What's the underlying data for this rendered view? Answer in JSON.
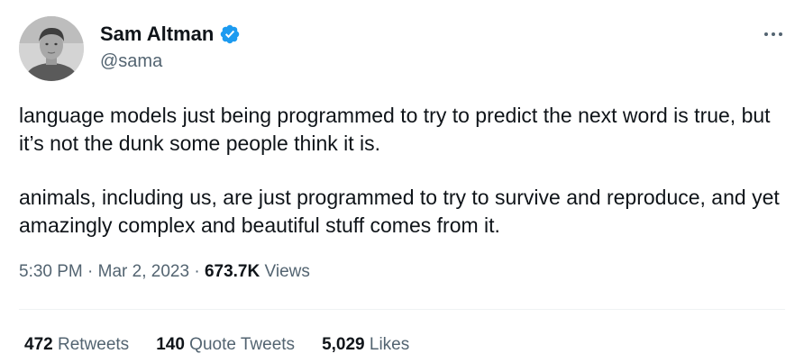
{
  "author": {
    "display_name": "Sam Altman",
    "handle": "@sama",
    "verified": true,
    "verified_color": "#1d9bf0"
  },
  "tweet": {
    "paragraphs": [
      "language models just being programmed to try to predict the next word is true, but it’s not the dunk some people think it is.",
      "animals, including us, are just programmed to try to survive and reproduce, and yet amazingly complex and beautiful stuff comes from it."
    ],
    "time": "5:30 PM",
    "separator": "·",
    "date": "Mar 2, 2023",
    "views_count": "673.7K",
    "views_label": "Views"
  },
  "stats": {
    "retweets": {
      "count": "472",
      "label": "Retweets"
    },
    "quote_tweets": {
      "count": "140",
      "label": "Quote Tweets"
    },
    "likes": {
      "count": "5,029",
      "label": "Likes"
    }
  },
  "icons": {
    "more": "more-horizontal-icon",
    "verified": "verified-badge-icon"
  },
  "colors": {
    "text_primary": "#0f1419",
    "text_secondary": "#536471",
    "divider": "#eff3f4"
  }
}
